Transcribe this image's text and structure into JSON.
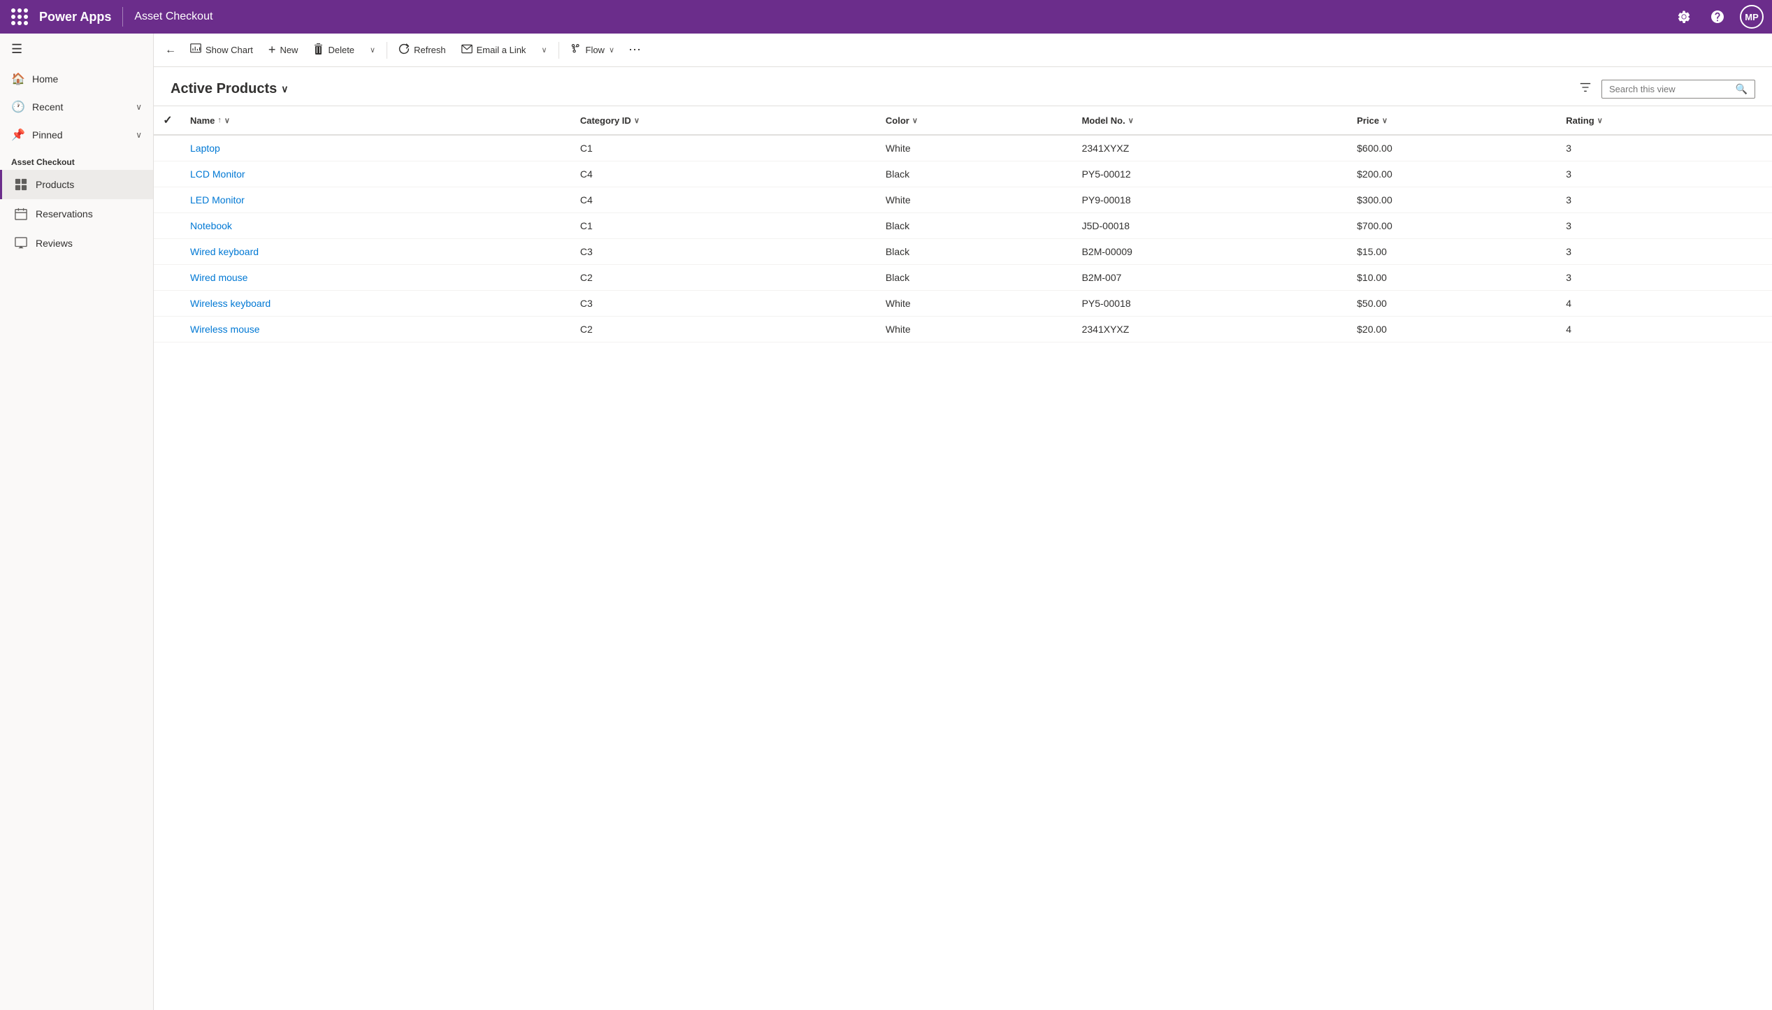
{
  "topBar": {
    "brand": "Power Apps",
    "appName": "Asset Checkout",
    "settingsLabel": "Settings",
    "helpLabel": "Help",
    "avatar": "MP"
  },
  "sidebar": {
    "homeLabel": "Home",
    "recentLabel": "Recent",
    "pinnedLabel": "Pinned",
    "sectionTitle": "Asset Checkout",
    "items": [
      {
        "id": "products",
        "label": "Products",
        "active": true
      },
      {
        "id": "reservations",
        "label": "Reservations",
        "active": false
      },
      {
        "id": "reviews",
        "label": "Reviews",
        "active": false
      }
    ]
  },
  "toolbar": {
    "backLabel": "←",
    "showChartLabel": "Show Chart",
    "newLabel": "New",
    "deleteLabel": "Delete",
    "refreshLabel": "Refresh",
    "emailLinkLabel": "Email a Link",
    "flowLabel": "Flow",
    "moreLabel": "⋯"
  },
  "contentHeader": {
    "title": "Active Products",
    "searchPlaceholder": "Search this view"
  },
  "table": {
    "columns": [
      {
        "id": "name",
        "label": "Name",
        "sortable": true,
        "sortDir": "asc"
      },
      {
        "id": "categoryId",
        "label": "Category ID",
        "sortable": true
      },
      {
        "id": "color",
        "label": "Color",
        "sortable": true
      },
      {
        "id": "modelNo",
        "label": "Model No.",
        "sortable": true
      },
      {
        "id": "price",
        "label": "Price",
        "sortable": true
      },
      {
        "id": "rating",
        "label": "Rating",
        "sortable": true
      }
    ],
    "rows": [
      {
        "name": "Laptop",
        "categoryId": "C1",
        "color": "White",
        "modelNo": "2341XYXZ",
        "price": "$600.00",
        "rating": "3"
      },
      {
        "name": "LCD Monitor",
        "categoryId": "C4",
        "color": "Black",
        "modelNo": "PY5-00012",
        "price": "$200.00",
        "rating": "3"
      },
      {
        "name": "LED Monitor",
        "categoryId": "C4",
        "color": "White",
        "modelNo": "PY9-00018",
        "price": "$300.00",
        "rating": "3"
      },
      {
        "name": "Notebook",
        "categoryId": "C1",
        "color": "Black",
        "modelNo": "J5D-00018",
        "price": "$700.00",
        "rating": "3"
      },
      {
        "name": "Wired keyboard",
        "categoryId": "C3",
        "color": "Black",
        "modelNo": "B2M-00009",
        "price": "$15.00",
        "rating": "3"
      },
      {
        "name": "Wired mouse",
        "categoryId": "C2",
        "color": "Black",
        "modelNo": "B2M-007",
        "price": "$10.00",
        "rating": "3"
      },
      {
        "name": "Wireless keyboard",
        "categoryId": "C3",
        "color": "White",
        "modelNo": "PY5-00018",
        "price": "$50.00",
        "rating": "4"
      },
      {
        "name": "Wireless mouse",
        "categoryId": "C2",
        "color": "White",
        "modelNo": "2341XYXZ",
        "price": "$20.00",
        "rating": "4"
      }
    ]
  }
}
